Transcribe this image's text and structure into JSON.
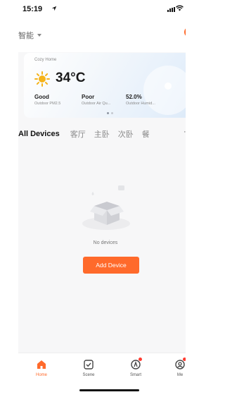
{
  "status_bar": {
    "time": "15:19"
  },
  "header": {
    "home_switcher": "智能"
  },
  "weather": {
    "home_name": "Cozy Home",
    "temperature": "34°C",
    "metrics": [
      {
        "value": "Good",
        "label": "Outdoor PM2.5"
      },
      {
        "value": "Poor",
        "label": "Outdoor Air Qu..."
      },
      {
        "value": "52.0%",
        "label": "Outdoor Humid..."
      }
    ]
  },
  "rooms": {
    "tabs": [
      "All Devices",
      "客厅",
      "主卧",
      "次卧",
      "餐"
    ],
    "active_index": 0
  },
  "empty_state": {
    "message": "No devices",
    "button_label": "Add Device"
  },
  "tab_bar": {
    "items": [
      {
        "label": "Home",
        "icon": "home-icon",
        "active": true
      },
      {
        "label": "Scene",
        "icon": "scene-icon",
        "active": false
      },
      {
        "label": "Smart",
        "icon": "smart-icon",
        "active": false
      },
      {
        "label": "Me",
        "icon": "me-icon",
        "active": false
      }
    ]
  },
  "colors": {
    "accent": "#ff6a2b",
    "badge": "#ff3b30",
    "background": "#f7f7f8"
  }
}
